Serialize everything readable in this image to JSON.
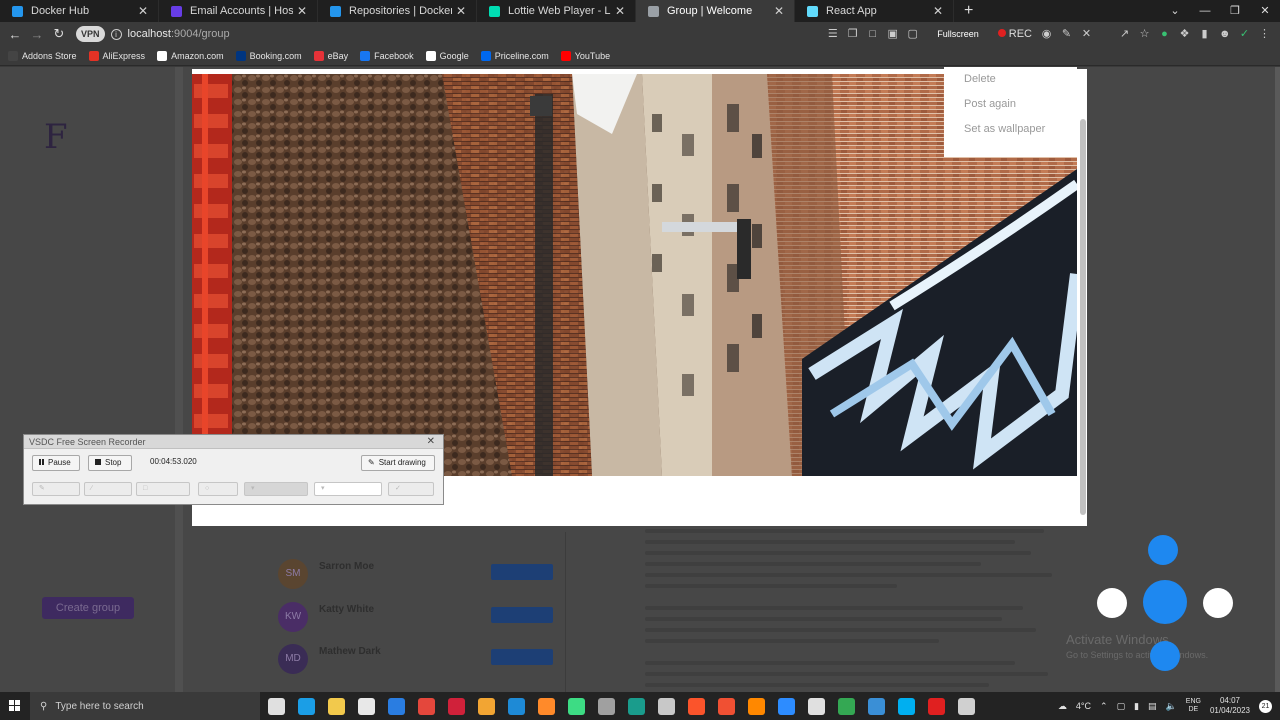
{
  "browser": {
    "tabs": [
      {
        "title": "Docker Hub",
        "color": "#2496ed",
        "active": false
      },
      {
        "title": "Email Accounts | Hostinger",
        "color": "#673de6",
        "active": false
      },
      {
        "title": "Repositories | Docker Hub",
        "color": "#2496ed",
        "active": false
      },
      {
        "title": "Lottie Web Player - Lottiefiles",
        "color": "#00ddb3",
        "active": false
      },
      {
        "title": "Group | Welcome",
        "color": "#9aa0a6",
        "active": true
      },
      {
        "title": "React App",
        "color": "#61dafb",
        "active": false
      }
    ],
    "new_tab": "+",
    "vpn_label": "VPN",
    "url_host": "localhost",
    "url_path": ":9004/group",
    "fullscreen_label": "Fullscreen",
    "rec_label": "REC",
    "bookmarks": [
      {
        "label": "Addons Store",
        "color": "#444444",
        "icon": "grid-icon"
      },
      {
        "label": "AliExpress",
        "color": "#e43225",
        "icon": "aliexpress-icon"
      },
      {
        "label": "Amazon.com",
        "color": "#ffffff",
        "icon": "amazon-icon"
      },
      {
        "label": "Booking.com",
        "color": "#003580",
        "icon": "booking-icon"
      },
      {
        "label": "eBay",
        "color": "#e53238",
        "icon": "ebay-icon"
      },
      {
        "label": "Facebook",
        "color": "#1877f2",
        "icon": "facebook-icon"
      },
      {
        "label": "Google",
        "color": "#ffffff",
        "icon": "google-icon"
      },
      {
        "label": "Priceline.com",
        "color": "#0068ef",
        "icon": "priceline-icon"
      },
      {
        "label": "YouTube",
        "color": "#ff0000",
        "icon": "youtube-icon"
      }
    ]
  },
  "app": {
    "logo": "F",
    "create_group_label": "Create group",
    "members": [
      {
        "name": "Sarron Moe",
        "initials": "SM",
        "avatar_color": "#5a4530"
      },
      {
        "name": "Katty White",
        "initials": "KW",
        "avatar_color": "#4a2d66"
      },
      {
        "name": "Mathew Dark",
        "initials": "MD",
        "avatar_color": "#3a2c55"
      }
    ],
    "accent_color": "#5b2d99"
  },
  "context_menu": {
    "items": [
      "Delete",
      "Post again",
      "Set as wallpaper"
    ]
  },
  "recorder": {
    "title": "VSDC Free Screen Recorder",
    "pause_label": "Pause",
    "stop_label": "Stop",
    "timer": "00:04:53.020",
    "start_drawing_label": "Start drawing"
  },
  "watermark": {
    "line1": "Activate Windows",
    "line2": "Go to Settings to activate Windows."
  },
  "taskbar": {
    "search_placeholder": "Type here to search",
    "temperature": "4°C",
    "lang1": "ENG",
    "lang2": "DE",
    "time": "04:07",
    "date": "01/04/2023",
    "notification_count": "21"
  }
}
